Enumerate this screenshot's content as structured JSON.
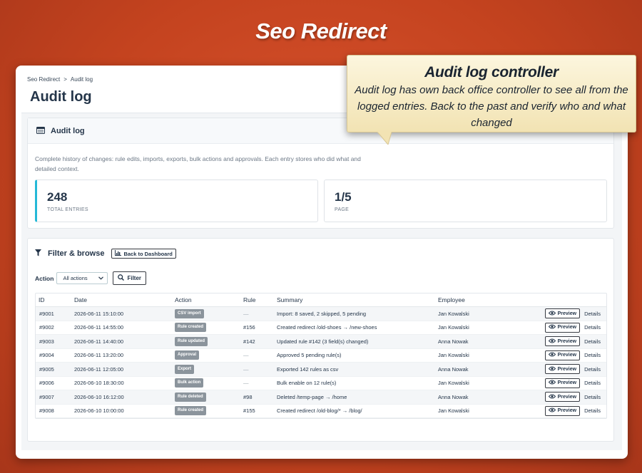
{
  "promo": {
    "title": "Seo Redirect",
    "tooltip_title": "Audit log controller",
    "tooltip_text": "Audit log has own back office controller to see all from the logged entries. Back to the past and verify who and what changed"
  },
  "breadcrumb": {
    "parent": "Seo Redirect",
    "separator": ">",
    "current": "Audit log"
  },
  "page_title": "Audit log",
  "audit_card": {
    "title": "Audit log",
    "description": "Complete history of changes: rule edits, imports, exports, bulk actions and approvals. Each entry stores who did what and detailed context.",
    "stats": [
      {
        "value": "248",
        "label": "TOTAL ENTRIES"
      },
      {
        "value": "1/5",
        "label": "PAGE"
      }
    ]
  },
  "filter_card": {
    "title": "Filter & browse",
    "back_button": "Back to Dashboard",
    "action_label": "Action",
    "action_select": "All actions",
    "filter_button": "Filter"
  },
  "table": {
    "headers": {
      "id": "ID",
      "date": "Date",
      "action": "Action",
      "rule": "Rule",
      "summary": "Summary",
      "employee": "Employee"
    },
    "preview_label": "Preview",
    "details_label": "Details",
    "rows": [
      {
        "id": "#9001",
        "date": "2026-06-11 15:10:00",
        "action": "CSV import",
        "rule": "—",
        "summary": "Import: 8 saved, 2 skipped, 5 pending",
        "employee": "Jan Kowalski"
      },
      {
        "id": "#9002",
        "date": "2026-06-11 14:55:00",
        "action": "Rule created",
        "rule": "#156",
        "summary": "Created redirect /old-shoes → /new-shoes",
        "employee": "Jan Kowalski"
      },
      {
        "id": "#9003",
        "date": "2026-06-11 14:40:00",
        "action": "Rule updated",
        "rule": "#142",
        "summary": "Updated rule #142 (3 field(s) changed)",
        "employee": "Anna Nowak"
      },
      {
        "id": "#9004",
        "date": "2026-06-11 13:20:00",
        "action": "Approval",
        "rule": "—",
        "summary": "Approved 5 pending rule(s)",
        "employee": "Jan Kowalski"
      },
      {
        "id": "#9005",
        "date": "2026-06-11 12:05:00",
        "action": "Export",
        "rule": "—",
        "summary": "Exported 142 rules as csv",
        "employee": "Anna Nowak"
      },
      {
        "id": "#9006",
        "date": "2026-06-10 18:30:00",
        "action": "Bulk action",
        "rule": "—",
        "summary": "Bulk enable on 12 rule(s)",
        "employee": "Jan Kowalski"
      },
      {
        "id": "#9007",
        "date": "2026-06-10 16:12:00",
        "action": "Rule deleted",
        "rule": "#98",
        "summary": "Deleted /temp-page → /home",
        "employee": "Anna Nowak"
      },
      {
        "id": "#9008",
        "date": "2026-06-10 10:00:00",
        "action": "Rule created",
        "rule": "#155",
        "summary": "Created redirect /old-blog/* → /blog/",
        "employee": "Jan Kowalski"
      }
    ]
  }
}
